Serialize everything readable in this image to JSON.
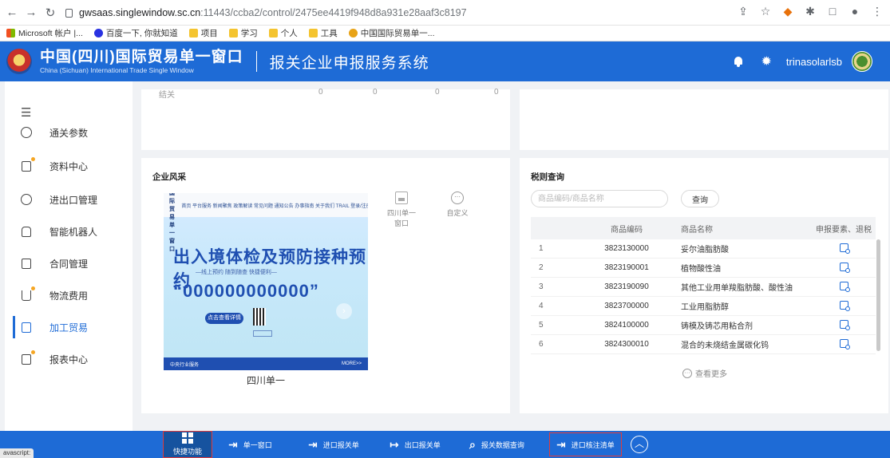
{
  "browser": {
    "url_host": "gwsaas.singlewindow.sc.cn",
    "url_rest": ":11443/ccba2/control/2475ee4419f948d8a931e28aaf3c8197",
    "bookmarks": [
      "Microsoft 帐户 |...",
      "百度一下, 你就知道",
      "项目",
      "学习",
      "个人",
      "工具",
      "中国国际贸易单一..."
    ]
  },
  "header": {
    "brand_cn": "中国(四川)国际贸易单一窗口",
    "brand_en": "China (Sichuan) International Trade Single Window",
    "system_title": "报关企业申报服务系统",
    "username": "trinasolarlsb"
  },
  "sidebar": {
    "items": [
      {
        "label": "通关参数",
        "icon": "globe-icon"
      },
      {
        "label": "资料中心",
        "icon": "document-icon"
      },
      {
        "label": "进出口管理",
        "icon": "check-circle-icon"
      },
      {
        "label": "智能机器人",
        "icon": "robot-icon"
      },
      {
        "label": "合同管理",
        "icon": "contract-icon"
      },
      {
        "label": "物流费用",
        "icon": "cart-icon"
      },
      {
        "label": "加工贸易",
        "icon": "processing-icon"
      },
      {
        "label": "报表中心",
        "icon": "report-icon"
      }
    ],
    "active_color": "#1e6bd6"
  },
  "top_left_cut": {
    "label": "结关",
    "values": [
      "0",
      "0",
      "0",
      "0"
    ]
  },
  "fengcai": {
    "title": "企业风采",
    "banner": {
      "top_name": "中国(四川)国际贸易单一窗口",
      "top_menu": "首页 平台服务 新闻聚焦 政策解读 常见问题 通知公告 办事指南 关于我们 TRAIL 登录/注册",
      "title": "出入境体检及预防接种预约",
      "subtitle": "—线上预约 随到随查 快捷便利—",
      "phone": "“000000000000”",
      "button": "点击查看详情",
      "foot_left": "中央行业服务",
      "foot_right": "MORE>>"
    },
    "caption": "四川单一",
    "quick_links": [
      {
        "label": "四川单一窗口",
        "icon": "image-icon"
      },
      {
        "label": "自定义",
        "icon": "more-icon"
      }
    ]
  },
  "shuize": {
    "title": "税则查询",
    "search_placeholder": "商品编码/商品名称",
    "query_label": "查询",
    "columns": [
      "",
      "商品编码",
      "商品名称",
      "申报要素、退税"
    ],
    "rows": [
      {
        "idx": "1",
        "code": "3823130000",
        "name": "妥尔油脂肪酸"
      },
      {
        "idx": "2",
        "code": "3823190001",
        "name": "植物酸性油"
      },
      {
        "idx": "3",
        "code": "3823190090",
        "name": "其他工业用单羧脂肪酸、酸性油"
      },
      {
        "idx": "4",
        "code": "3823700000",
        "name": "工业用脂肪醇"
      },
      {
        "idx": "5",
        "code": "3824100000",
        "name": "铸模及铸芯用粘合剂"
      },
      {
        "idx": "6",
        "code": "3824300010",
        "name": "混合的未烧结金属碳化钨"
      }
    ],
    "more_label": "查看更多"
  },
  "bottom_bar": {
    "status_text": "avascript:",
    "quick_label": "快捷功能",
    "items": [
      {
        "label": "单一窗口",
        "icon": "login-arrow-icon"
      },
      {
        "label": "进口报关单",
        "icon": "login-arrow-icon"
      },
      {
        "label": "出口报关单",
        "icon": "logout-arrow-icon"
      },
      {
        "label": "报关数据查询",
        "icon": "search-icon"
      },
      {
        "label": "进口核注清单",
        "icon": "login-arrow-icon"
      }
    ],
    "highlight_color": "#e03c3c"
  }
}
